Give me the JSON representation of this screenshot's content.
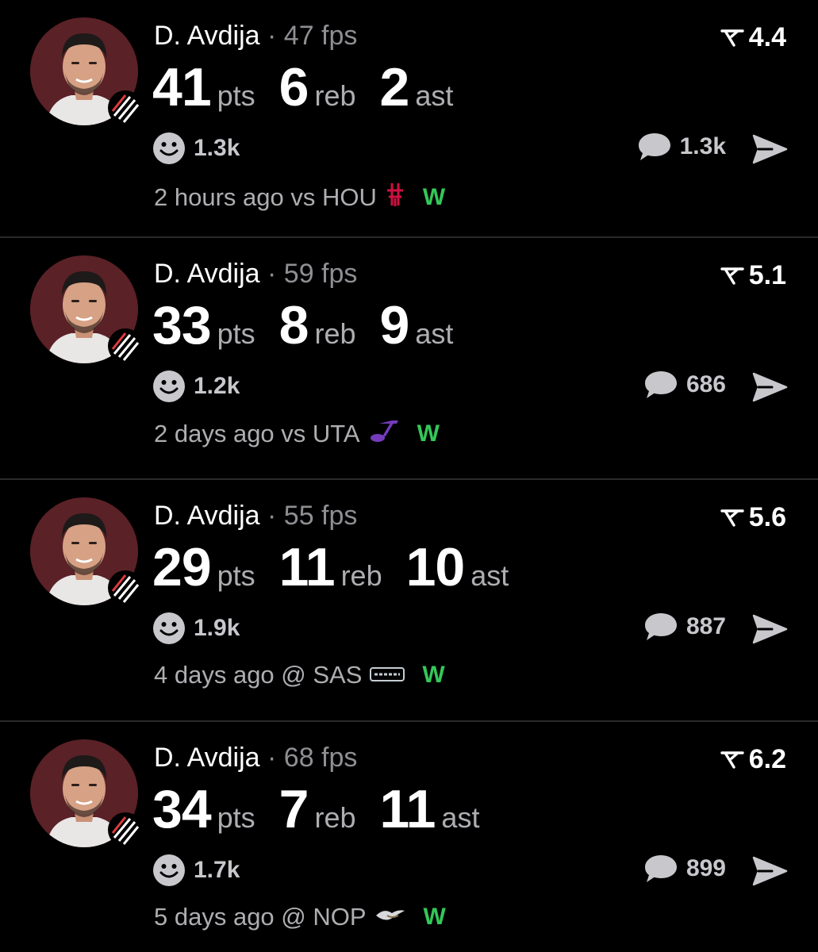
{
  "posts": [
    {
      "player": "D. Avdija",
      "fps": "· 47 fps",
      "rating": "4.4",
      "stats": [
        {
          "value": "41",
          "unit": "pts"
        },
        {
          "value": "6",
          "unit": "reb"
        },
        {
          "value": "2",
          "unit": "ast"
        }
      ],
      "reactions": "1.3k",
      "comments": "1.3k",
      "time_opponent": "2 hours ago vs HOU",
      "opponent_logo": "rockets-logo",
      "result": "W"
    },
    {
      "player": "D. Avdija",
      "fps": "· 59 fps",
      "rating": "5.1",
      "stats": [
        {
          "value": "33",
          "unit": "pts"
        },
        {
          "value": "8",
          "unit": "reb"
        },
        {
          "value": "9",
          "unit": "ast"
        }
      ],
      "reactions": "1.2k",
      "comments": "686",
      "time_opponent": "2 days ago vs UTA",
      "opponent_logo": "jazz-logo",
      "result": "W"
    },
    {
      "player": "D. Avdija",
      "fps": "· 55 fps",
      "rating": "5.6",
      "stats": [
        {
          "value": "29",
          "unit": "pts"
        },
        {
          "value": "11",
          "unit": "reb"
        },
        {
          "value": "10",
          "unit": "ast"
        }
      ],
      "reactions": "1.9k",
      "comments": "887",
      "time_opponent": "4 days ago @ SAS",
      "opponent_logo": "spurs-logo",
      "result": "W"
    },
    {
      "player": "D. Avdija",
      "fps": "· 68 fps",
      "rating": "6.2",
      "stats": [
        {
          "value": "34",
          "unit": "pts"
        },
        {
          "value": "7",
          "unit": "reb"
        },
        {
          "value": "11",
          "unit": "ast"
        }
      ],
      "reactions": "1.7k",
      "comments": "899",
      "time_opponent": "5 days ago @ NOP",
      "opponent_logo": "pelicans-logo",
      "result": "W"
    }
  ],
  "colors": {
    "background": "#000000",
    "divider": "#2a2a2c",
    "muted_text": "#8e8e93",
    "win": "#34c759",
    "avatar_bg": "#5a2126",
    "rockets_red": "#ce1141",
    "jazz_purple": "#753bbd",
    "spurs_silver": "#c4ced4"
  },
  "icons": {
    "rating": "rating-arrow-icon",
    "reactions": "smiley-icon",
    "comments": "speech-bubble-icon",
    "share": "paper-plane-icon",
    "team_badge": "trail-blazers-pinwheel-icon"
  }
}
